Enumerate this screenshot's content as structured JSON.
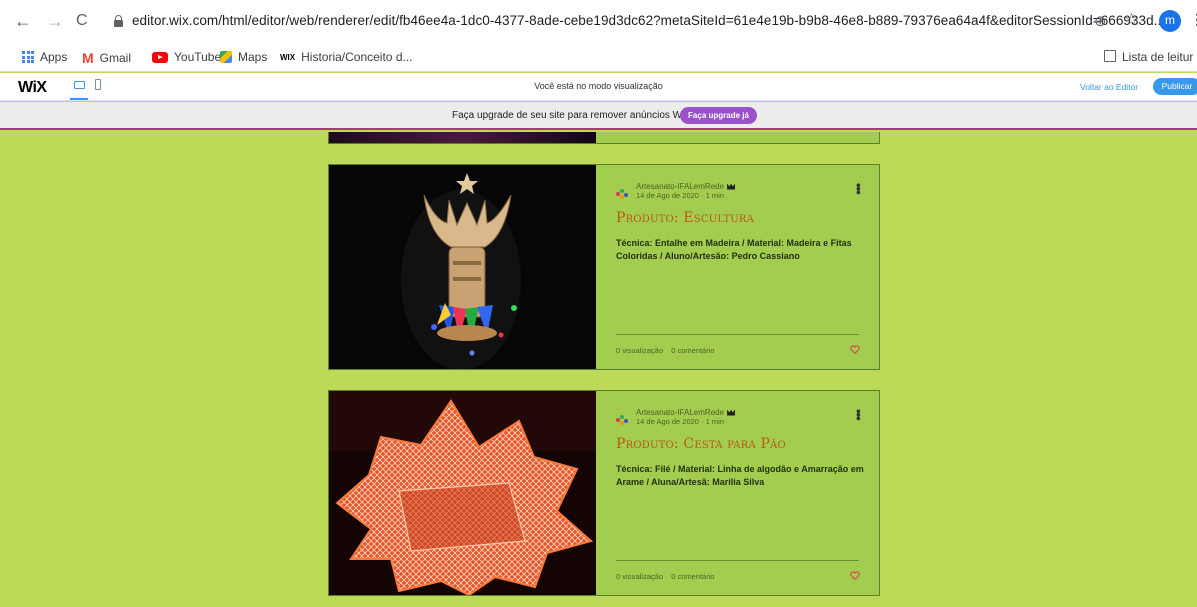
{
  "browser": {
    "url": "editor.wix.com/html/editor/web/renderer/edit/fb46ee4a-1dc0-4377-8ade-cebe19d3dc62?metaSiteId=61e4e19b-b9b8-46e8-b889-79376ea64a4f&editorSessionId=666933d...",
    "back_icon": "←",
    "forward_icon": "→",
    "reload_icon": "C",
    "zoom_icon": "⊕",
    "star_icon": "☆",
    "avatar_letter": "m",
    "menu_icon": "⋮"
  },
  "bookmarks": {
    "items": [
      {
        "label": "Apps"
      },
      {
        "label": "Gmail",
        "icon_text": "M"
      },
      {
        "label": "YouTube"
      },
      {
        "label": "Maps"
      },
      {
        "label": "Historia/Conceito d...",
        "icon_text": "WIX"
      }
    ],
    "reading_list": "Lista de leitur"
  },
  "wix_bar": {
    "logo": "WiX",
    "preview_message": "Você está no modo visualização",
    "back_to_editor": "Voltar ao Editor",
    "publish": "Publicar"
  },
  "upgrade_banner": {
    "text": "Faça upgrade de seu site para remover anúncios Wix",
    "button": "Faça upgrade já"
  },
  "posts": [
    {
      "author": "Artesanato-IFALemRede",
      "date": "14 de Ago de 2020",
      "read_time": "1 min",
      "title": "Produto: Escultura",
      "description": "Técnica: Entalhe em Madeira / Material: Madeira e Fitas Coloridas / Aluno/Artesão: Pedro Cassiano",
      "views": "0 visualização",
      "comments": "0 comentário"
    },
    {
      "author": "Artesanato-IFALemRede",
      "date": "14 de Ago de 2020",
      "read_time": "1 min",
      "title": "Produto: Cesta para Pão",
      "description": "Técnica: Filé / Material: Linha de algodão e Amarração em Arame / Aluna/Artesã: Marília Silva",
      "views": "0 visualização",
      "comments": "0 comentário"
    }
  ],
  "colors": {
    "page_background": "#bcd957",
    "card_background": "#a3cd4f",
    "title_color": "#b85a10",
    "wix_accent": "#3899ec",
    "upgrade_button": "#9a52cc"
  }
}
